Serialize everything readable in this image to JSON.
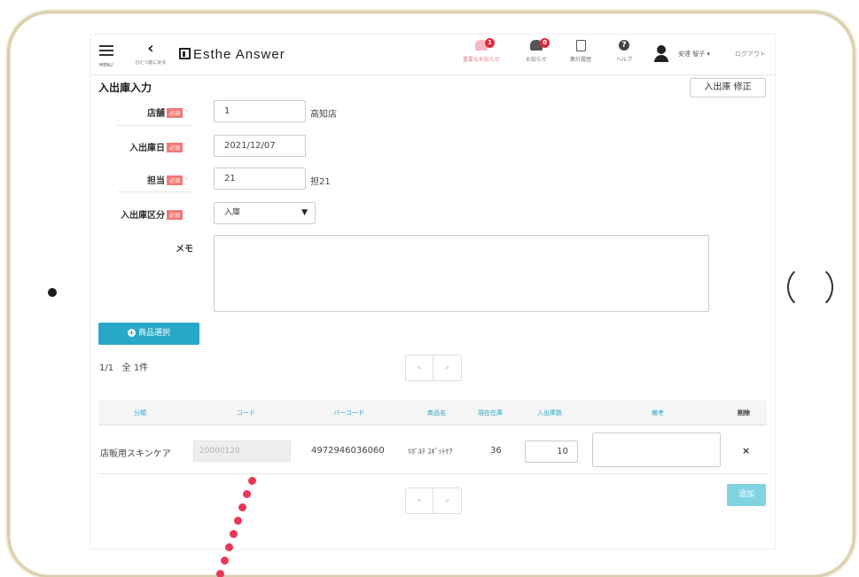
{
  "header": {
    "menu_label": "MENU",
    "back_label": "ひとつ前に戻る",
    "logo": "Esthe Answer",
    "important_notice": {
      "label": "重要なお知らせ",
      "count": "1"
    },
    "notice": {
      "label": "お知らせ",
      "count": "0"
    },
    "summary_history": {
      "label": "集計履歴"
    },
    "help": {
      "label": "ヘルプ"
    },
    "user_name": "安達 智子 ▾",
    "logout": "ログアウト",
    "colors": {
      "badge": "#e0293a"
    }
  },
  "page": {
    "title": "入出庫入力",
    "modify_button": "入出庫 修正"
  },
  "form": {
    "required_badge": "必須",
    "store": {
      "label": "店舗",
      "value": "1",
      "name": "高知店"
    },
    "date": {
      "label": "入出庫日",
      "value": "2021/12/07"
    },
    "staff": {
      "label": "担当",
      "value": "21",
      "name": "担21"
    },
    "type": {
      "label": "入出庫区分",
      "value": "入庫"
    },
    "memo": {
      "label": "メモ",
      "value": ""
    }
  },
  "product_select_button": "商品選択",
  "pager": {
    "page": "1/1",
    "total": "全 1件",
    "prev": "«",
    "next": "»"
  },
  "table": {
    "headers": [
      "分類",
      "コード",
      "バーコード",
      "商品名",
      "現在在庫",
      "入出庫数",
      "備考",
      "削除"
    ],
    "rows": [
      {
        "category": "店販用スキンケア",
        "code": "20000120",
        "barcode": "4972946036060",
        "product_name": "ﾘﾎﾞﾙﾃ ｽｷﾞｯﾄｹｱ",
        "current_stock": "36",
        "quantity": "10",
        "note": "",
        "delete": "×"
      }
    ]
  },
  "add_button": "追加",
  "colors": {
    "accent": "#27a8c7",
    "required": "#f07a7a",
    "annotation_dots": "#e8385a"
  }
}
